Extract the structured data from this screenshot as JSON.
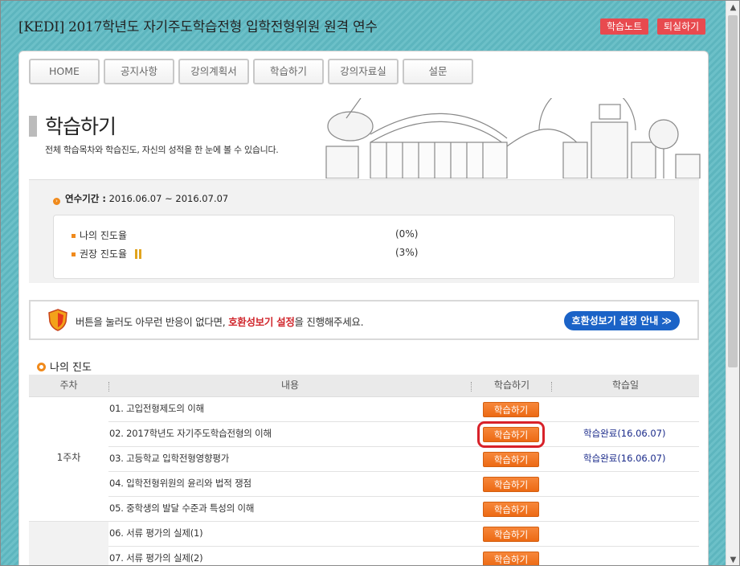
{
  "app": {
    "title": "[KEDI] 2017학년도 자기주도학습전형 입학전형위원 원격 연수",
    "btn_note": "학습노트",
    "btn_exit": "퇴실하기"
  },
  "nav": {
    "tabs": [
      "HOME",
      "공지사항",
      "강의계획서",
      "학습하기",
      "강의자료실",
      "설문"
    ]
  },
  "hero": {
    "title": "학습하기",
    "subtitle": "전체 학습목차와 학습진도, 자신의 성적을 한 눈에 볼 수 있습니다."
  },
  "period": {
    "label": "연수기간 :",
    "value": "2016.06.07 ~ 2016.07.07"
  },
  "progress": {
    "my_label": "나의 진도율",
    "my_value": "(0%)",
    "rec_label": "권장 진도율",
    "rec_value": "(3%)"
  },
  "notice": {
    "text_before": "버튼을 눌러도 아무런 반응이 없다면,",
    "highlight": "호환성보기 설정",
    "text_after": "을 진행해주세요.",
    "guide_button": "호환성보기 설정 안내 ≫"
  },
  "section": {
    "title": "나의 진도"
  },
  "table": {
    "headers": {
      "week": "주차",
      "content": "내용",
      "study": "학습하기",
      "date": "학습일"
    },
    "week1": "1주차",
    "rows": [
      {
        "content": "01. 고입전형제도의 이해",
        "button": "학습하기",
        "date": ""
      },
      {
        "content": "02. 2017학년도 자기주도학습전형의 이해",
        "button": "학습하기",
        "date": "학습완료(16.06.07)"
      },
      {
        "content": "03. 고등학교 입학전형영향평가",
        "button": "학습하기",
        "date": "학습완료(16.06.07)"
      },
      {
        "content": "04. 입학전형위원의 윤리와 법적 쟁점",
        "button": "학습하기",
        "date": ""
      },
      {
        "content": "05. 중학생의 발달 수준과 특성의 이해",
        "button": "학습하기",
        "date": ""
      },
      {
        "content": "06. 서류 평가의 실제(1)",
        "button": "학습하기",
        "date": ""
      },
      {
        "content": "07. 서류 평가의 실제(2)",
        "button": "학습하기",
        "date": ""
      }
    ]
  },
  "colors": {
    "accent_orange": "#ec6a14",
    "top_button_red": "#e84a4f",
    "guide_blue": "#1b63c7",
    "done_text": "#1a2a8a",
    "background_teal": "#6cc0c8"
  }
}
